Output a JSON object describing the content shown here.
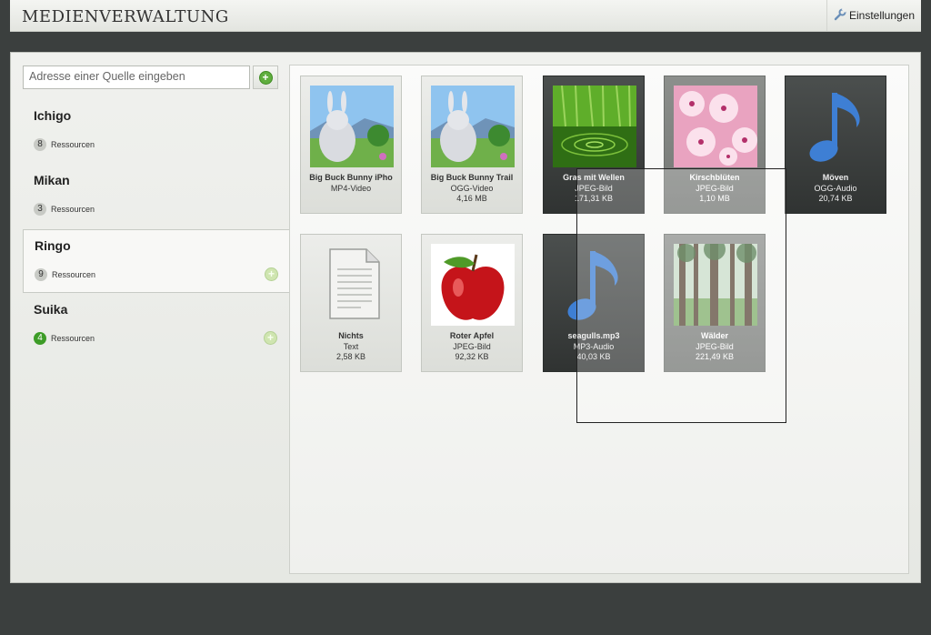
{
  "app": {
    "title": "MEDIENVERWALTUNG",
    "settings_label": "Einstellungen"
  },
  "sidebar": {
    "placeholder": "Adresse einer Quelle eingeben",
    "sources": [
      {
        "name": "Ichigo",
        "count": "8",
        "label": "Ressourcen"
      },
      {
        "name": "Mikan",
        "count": "3",
        "label": "Ressourcen"
      },
      {
        "name": "Ringo",
        "count": "9",
        "label": "Ressourcen"
      },
      {
        "name": "Suika",
        "count": "4",
        "label": "Ressourcen"
      }
    ]
  },
  "media": [
    {
      "name": "Big Buck Bunny iPho",
      "type": "MP4-Video",
      "size": "",
      "thumb": "bunny"
    },
    {
      "name": "Big Buck Bunny Trail",
      "type": "OGG-Video",
      "size": "4,16 MB",
      "thumb": "bunny"
    },
    {
      "name": "Gras mit Wellen",
      "type": "JPEG-Bild",
      "size": "171,31 KB",
      "thumb": "grass"
    },
    {
      "name": "Kirschblüten",
      "type": "JPEG-Bild",
      "size": "1,10 MB",
      "thumb": "cherry"
    },
    {
      "name": "Möven",
      "type": "OGG-Audio",
      "size": "20,74 KB",
      "thumb": "music-note"
    },
    {
      "name": "Nichts",
      "type": "Text",
      "size": "2,58 KB",
      "thumb": "document"
    },
    {
      "name": "Roter Apfel",
      "type": "JPEG-Bild",
      "size": "92,32 KB",
      "thumb": "apple"
    },
    {
      "name": "seagulls.mp3",
      "type": "MP3-Audio",
      "size": "40,03 KB",
      "thumb": "music-note"
    },
    {
      "name": "Wälder",
      "type": "JPEG-Bild",
      "size": "221,49 KB",
      "thumb": "forest"
    }
  ],
  "colors": {
    "accent_green": "#3d9c27",
    "background": "#3b3f3e"
  }
}
